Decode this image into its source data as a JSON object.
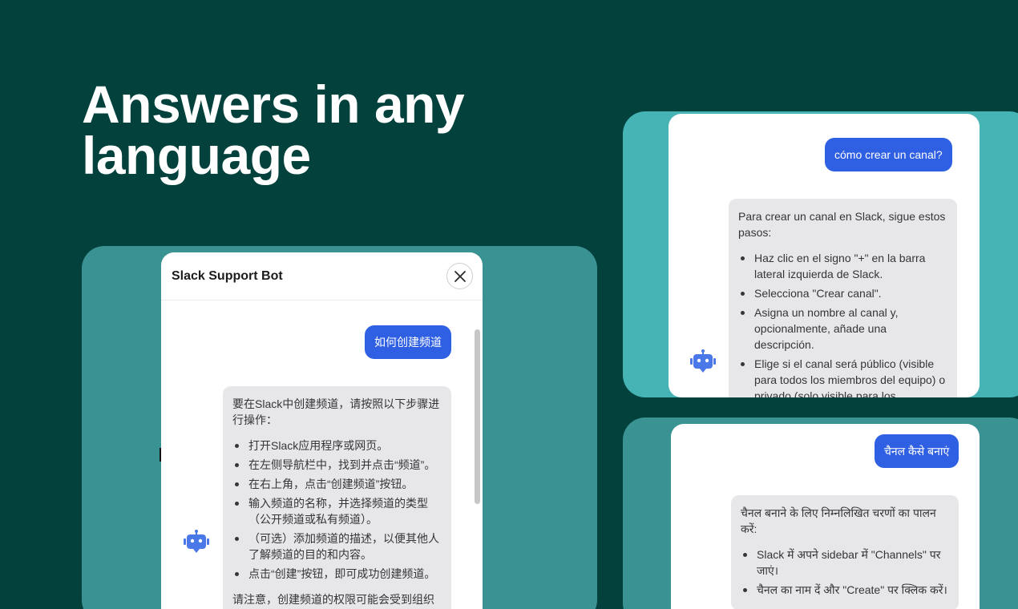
{
  "headline": {
    "line1": "Answers in any",
    "line2": "language"
  },
  "chinese_chat": {
    "title": "Slack Support Bot",
    "close_label": "×",
    "user_message": "如何创建频道",
    "bot_intro": "要在Slack中创建频道，请按照以下步骤进行操作：",
    "bot_steps": [
      "打开Slack应用程序或网页。",
      "在左侧导航栏中，找到并点击“频道”。",
      "在右上角，点击“创建频道”按钮。",
      "输入频道的名称，并选择频道的类型（公开频道或私有频道）。",
      "（可选）添加频道的描述，以便其他人了解频道的目的和内容。",
      "点击“创建”按钮，即可成功创建频道。"
    ],
    "bot_note": "请注意，创建频道的权限可能会受到组织"
  },
  "spanish_chat": {
    "user_message": "cómo crear un canal?",
    "bot_intro": "Para crear un canal en Slack, sigue estos pasos:",
    "bot_steps": [
      "Haz clic en el signo \"+\" en la barra lateral izquierda de Slack.",
      "Selecciona \"Crear canal\".",
      "Asigna un nombre al canal y, opcionalmente, añade una descripción.",
      "Elige si el canal será público (visible para todos los miembros del equipo) o privado (solo visible para los miembros invitados)."
    ]
  },
  "hindi_chat": {
    "user_message": "चैनल कैसे बनाएं",
    "bot_intro": "चैनल बनाने के लिए निम्नलिखित चरणों का पालन करें:",
    "bot_steps": [
      "Slack में अपने sidebar में \"Channels\" पर जाएं।",
      "चैनल का नाम दें और \"Create\" पर क्लिक करें।"
    ]
  },
  "colors": {
    "background": "#03413c",
    "panel_teal": "#3b9292",
    "panel_light_teal": "#46b3b5",
    "user_bubble": "#2f5fe3",
    "bot_bubble": "#e7e7ea",
    "bot_icon": "#4a78e8"
  },
  "icons": {
    "bot": "robot-icon",
    "close": "close-icon"
  }
}
